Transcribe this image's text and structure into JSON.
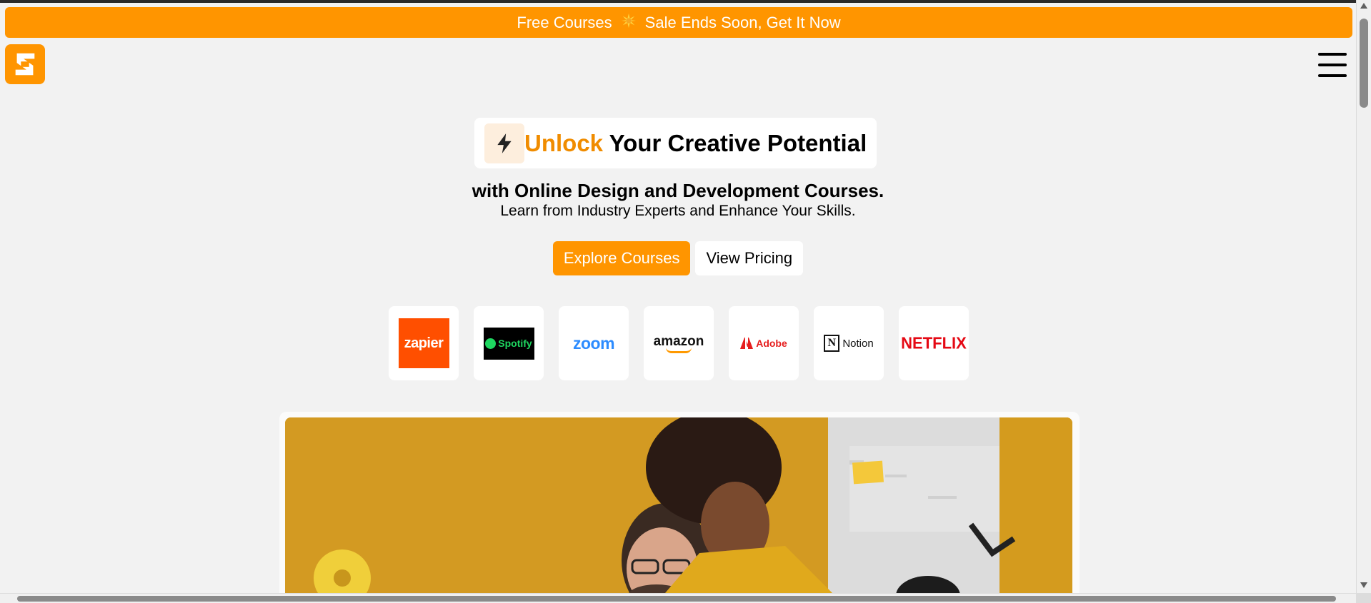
{
  "banner": {
    "text_left": "Free Courses",
    "spark_icon": "sparkle-icon",
    "text_right": "Sale Ends Soon, Get It Now"
  },
  "header": {
    "logo_icon": "s-logo-icon",
    "menu_icon": "hamburger-menu-icon"
  },
  "hero": {
    "title_accent": "Unlock",
    "title_rest": " Your Creative Potential",
    "subtitle": "with Online Design and Development Courses.",
    "description": "Learn from Industry Experts and Enhance Your Skills.",
    "primary_cta": "Explore Courses",
    "secondary_cta": "View Pricing"
  },
  "brands": [
    {
      "name": "zapier",
      "label": "zapier"
    },
    {
      "name": "spotify",
      "label": "Spotify"
    },
    {
      "name": "zoom",
      "label": "zoom"
    },
    {
      "name": "amazon",
      "label": "amazon"
    },
    {
      "name": "adobe",
      "label": "Adobe"
    },
    {
      "name": "notion",
      "label": "Notion"
    },
    {
      "name": "netflix",
      "label": "NETFLIX"
    }
  ],
  "colors": {
    "accent": "#ff9500",
    "background": "#f2f2f2",
    "title_accent": "#f08c00"
  }
}
